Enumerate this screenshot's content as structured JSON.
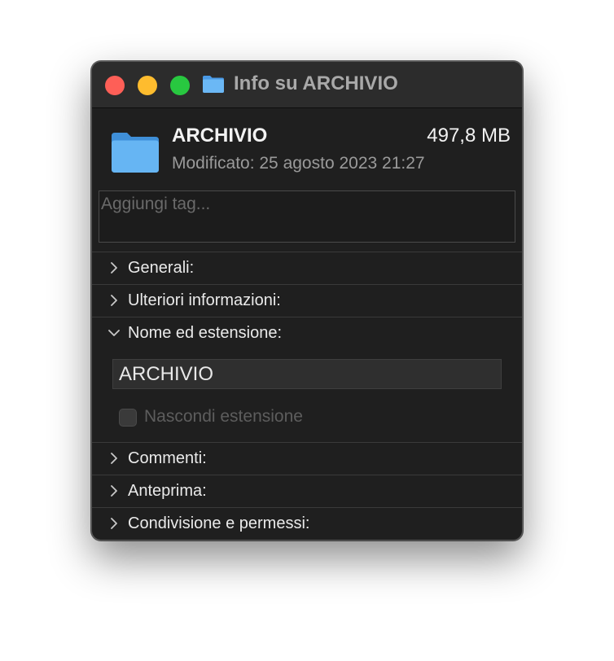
{
  "window": {
    "title": "Info su ARCHIVIO"
  },
  "file": {
    "name": "ARCHIVIO",
    "size": "497,8 MB",
    "modified": "Modificato: 25 agosto 2023 21:27",
    "icon": "folder-icon"
  },
  "tags": {
    "placeholder": "Aggiungi tag..."
  },
  "sections": {
    "generali": "Generali:",
    "ulteriori": "Ulteriori informazioni:",
    "nome": "Nome ed estensione:",
    "commenti": "Commenti:",
    "anteprima": "Anteprima:",
    "condivisione": "Condivisione e permessi:"
  },
  "name_extension": {
    "value": "ARCHIVIO",
    "hide_extension_label": "Nascondi estensione",
    "hide_extension_checked": false
  },
  "colors": {
    "close": "#fe5f57",
    "minimize": "#febc2e",
    "zoom": "#28c840",
    "folder": "#5aaaf0"
  }
}
